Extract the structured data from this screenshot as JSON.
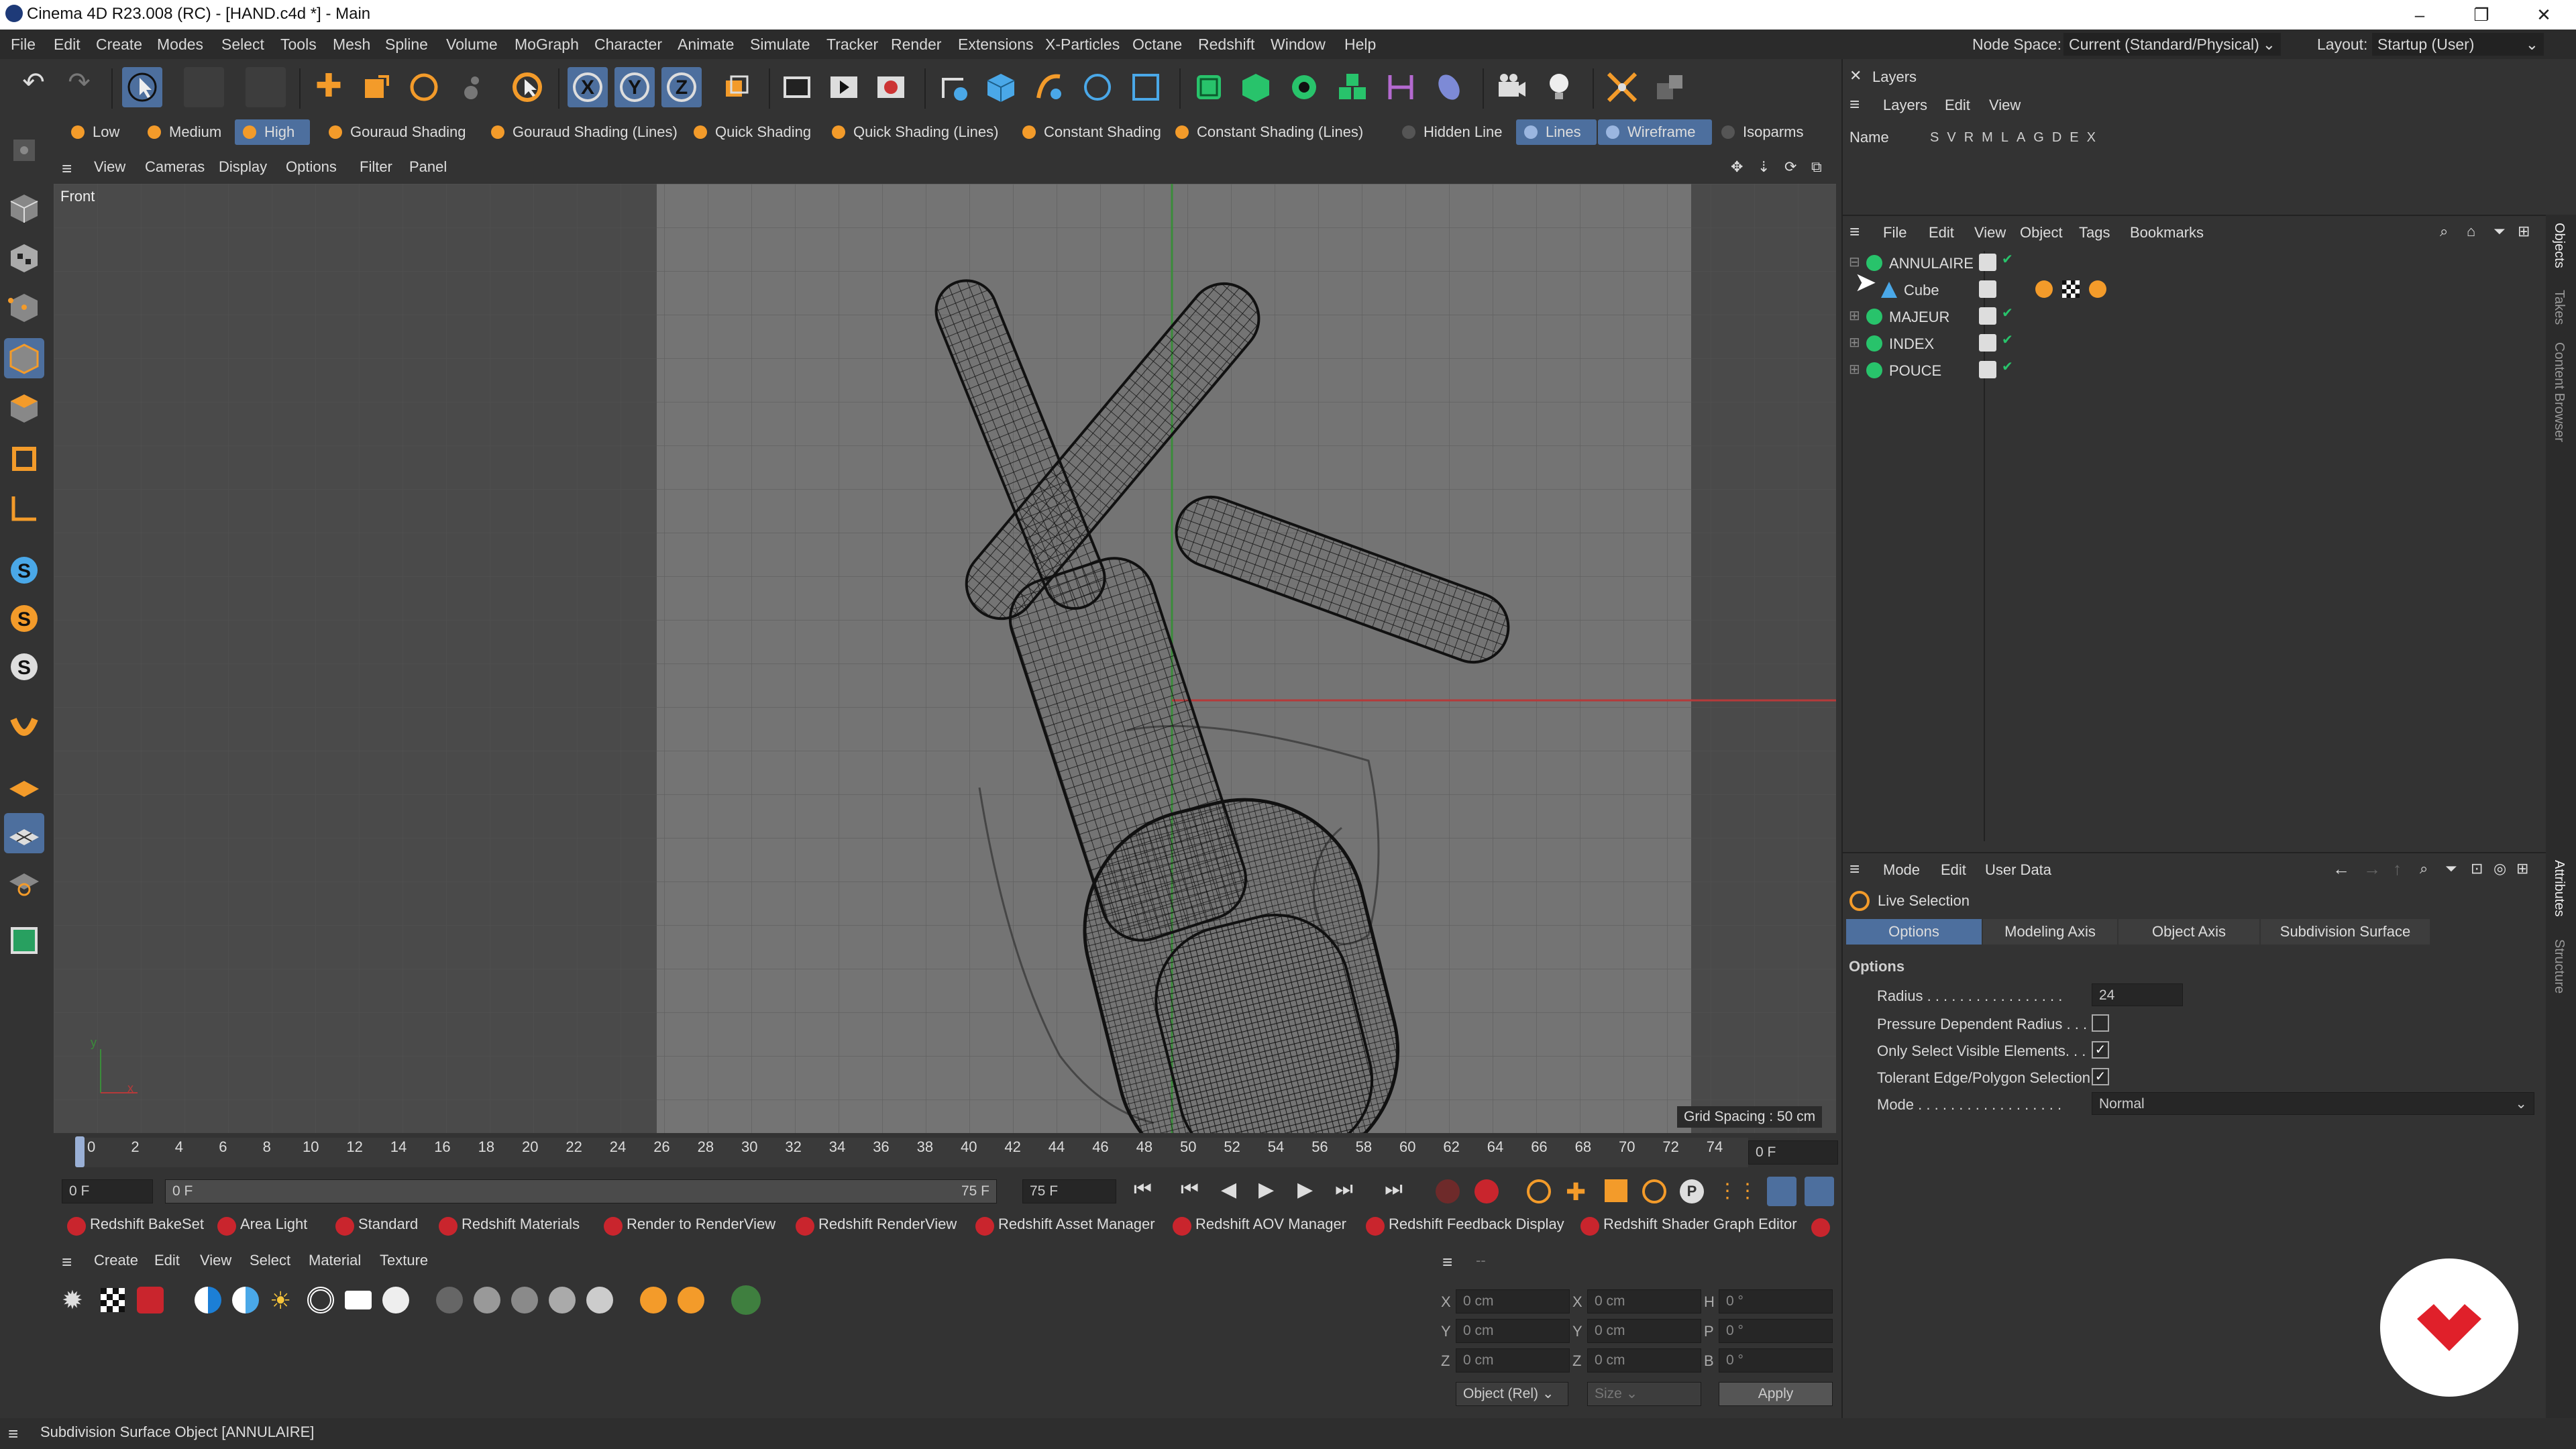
{
  "window": {
    "title": "Cinema 4D R23.008 (RC) - [HAND.c4d *] - Main",
    "controls": [
      "–",
      "❐",
      "✕"
    ]
  },
  "menu": {
    "items": [
      "File",
      "Edit",
      "Create",
      "Modes",
      "Select",
      "Tools",
      "Mesh",
      "Spline",
      "Volume",
      "MoGraph",
      "Character",
      "Animate",
      "Simulate",
      "Tracker",
      "Render",
      "Extensions",
      "X-Particles",
      "Octane",
      "Redshift",
      "Window",
      "Help"
    ],
    "node_space_label": "Node Space:",
    "node_space_value": "Current (Standard/Physical)",
    "layout_label": "Layout:",
    "layout_value": "Startup (User)"
  },
  "shading": {
    "chips": [
      "Low",
      "Medium",
      "High",
      "Gouraud Shading",
      "Gouraud Shading (Lines)",
      "Quick Shading",
      "Quick Shading (Lines)",
      "Constant Shading",
      "Constant Shading (Lines)",
      "Hidden Line",
      "Lines",
      "Wireframe",
      "Isoparms"
    ]
  },
  "viewmenu": {
    "items": [
      "View",
      "Cameras",
      "Display",
      "Options",
      "Filter",
      "Panel"
    ]
  },
  "viewport": {
    "name": "Front",
    "grid_spacing": "Grid Spacing : 50 cm",
    "axis_x": "x",
    "axis_y": "y"
  },
  "timeline": {
    "ticks": [
      "0",
      "2",
      "4",
      "6",
      "8",
      "10",
      "12",
      "14",
      "16",
      "18",
      "20",
      "22",
      "24",
      "26",
      "28",
      "30",
      "32",
      "34",
      "36",
      "38",
      "40",
      "42",
      "44",
      "46",
      "48",
      "50",
      "52",
      "54",
      "56",
      "58",
      "60",
      "62",
      "64",
      "66",
      "68",
      "70",
      "72",
      "74"
    ],
    "current_frame": "0 F",
    "start": "0 F",
    "range_start": "0 F",
    "range_end": "75 F",
    "end": "75 F"
  },
  "redshift_bar": {
    "items": [
      "Redshift BakeSet",
      "Area Light",
      "Standard",
      "Redshift Materials",
      "Render to RenderView",
      "Redshift RenderView",
      "Redshift Asset Manager",
      "Redshift AOV Manager",
      "Redshift Feedback Display",
      "Redshift Shader Graph Editor"
    ]
  },
  "material": {
    "menu": [
      "Create",
      "Edit",
      "View",
      "Select",
      "Material",
      "Texture"
    ]
  },
  "coords": {
    "rows": [
      {
        "a": "X",
        "av": "0 cm",
        "b": "X",
        "bv": "0 cm",
        "c": "H",
        "cv": "0 °"
      },
      {
        "a": "Y",
        "av": "0 cm",
        "b": "Y",
        "bv": "0 cm",
        "c": "P",
        "cv": "0 °"
      },
      {
        "a": "Z",
        "av": "0 cm",
        "b": "Z",
        "bv": "0 cm",
        "c": "B",
        "cv": "0 °"
      }
    ],
    "mode": "Object (Rel)",
    "size": "Size",
    "apply": "Apply",
    "header": "--"
  },
  "layers": {
    "title": "Layers",
    "menu": [
      "Layers",
      "Edit",
      "View"
    ],
    "columns": "Name",
    "flags": [
      "S",
      "V",
      "R",
      "M",
      "L",
      "A",
      "G",
      "D",
      "E",
      "X"
    ]
  },
  "objects": {
    "menu": [
      "File",
      "Edit",
      "View",
      "Object",
      "Tags",
      "Bookmarks"
    ],
    "items": [
      {
        "name": "ANNULAIRE",
        "child": false
      },
      {
        "name": "Cube",
        "child": true
      },
      {
        "name": "MAJEUR",
        "child": false
      },
      {
        "name": "INDEX",
        "child": false
      },
      {
        "name": "POUCE",
        "child": false
      }
    ],
    "side_tabs": [
      "Objects",
      "Takes",
      "Content Browser"
    ]
  },
  "attributes": {
    "menu": [
      "Mode",
      "Edit",
      "User Data"
    ],
    "tool": "Live Selection",
    "tabs": [
      "Options",
      "Modeling Axis",
      "Object Axis",
      "Subdivision Surface"
    ],
    "section": "Options",
    "radius_label": "Radius . . . . . . . . . . . . . . . . .",
    "radius_value": "24",
    "pressure_label": "Pressure Dependent Radius . . .",
    "visible_label": "Only Select Visible Elements. . .",
    "tolerant_label": "Tolerant Edge/Polygon Selection",
    "mode_label": "Mode . . . . . . . . . . . . . . . . . .",
    "mode_value": "Normal",
    "side_tabs": [
      "Attributes",
      "Structure"
    ]
  },
  "status": {
    "text": "Subdivision Surface Object [ANNULAIRE]"
  },
  "colors": {
    "accent": "#3e6fb5",
    "brand": "#e0202a",
    "wire": "#111111"
  }
}
